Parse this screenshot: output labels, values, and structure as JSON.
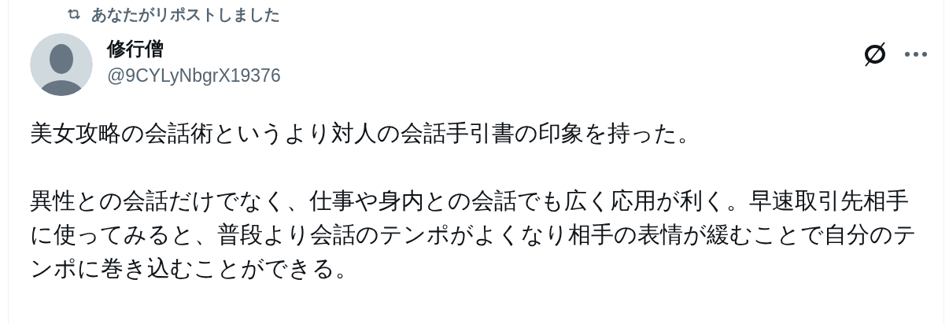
{
  "repost_label": "あなたがリポストしました",
  "author": {
    "name": "修行僧",
    "handle": "@9CYLyNbgrX19376"
  },
  "body": [
    "美女攻略の会話術というより対人の会話手引書の印象を持った。",
    "異性との会話だけでなく、仕事や身内との会話でも広く応用が利く。早速取引先相手に使ってみると、普段より会話のテンポがよくなり相手の表情が緩むことで自分のテンポに巻き込むことができる。"
  ]
}
